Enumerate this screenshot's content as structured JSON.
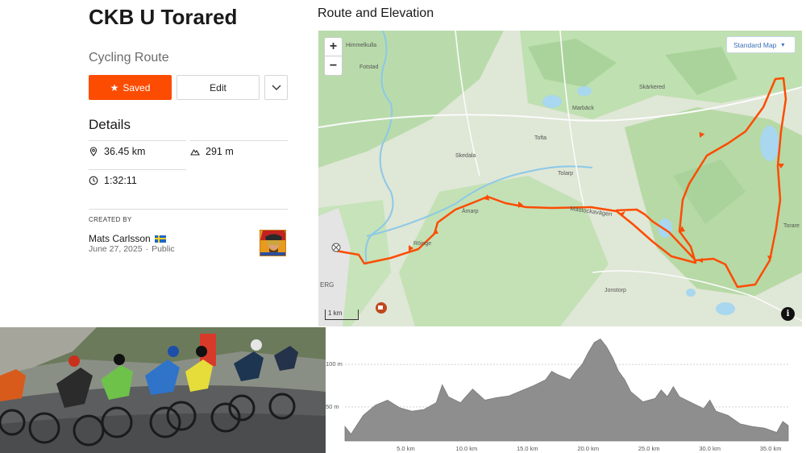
{
  "route": {
    "title": "CKB U Torared",
    "type": "Cycling Route",
    "actions": {
      "saved_label": "Saved",
      "edit_label": "Edit"
    }
  },
  "details": {
    "heading": "Details",
    "distance": "36.45 km",
    "elevation_gain": "291 m",
    "moving_time": "1:32:11"
  },
  "author": {
    "created_by_label": "CREATED BY",
    "name": "Mats Carlsson",
    "date": "June 27, 2025",
    "visibility": "Public"
  },
  "map": {
    "heading": "Route and Elevation",
    "style_selector": "Standard Map",
    "zoom_in": "+",
    "zoom_out": "−",
    "scale": "1 km",
    "info": "i",
    "places": [
      "Himmelkulla",
      "Fotstad",
      "Skedala",
      "Tofta",
      "Marbäck",
      "Skärkered",
      "Tolarp",
      "Åmarp",
      "Röinge",
      "Jonstorp",
      "Torare",
      "ERG"
    ],
    "road": "Mästockavägen",
    "route_color": "#fc4c02"
  },
  "chart_data": {
    "type": "area",
    "title": "",
    "xlabel": "",
    "ylabel": "",
    "x_unit": "km",
    "y_unit": "m",
    "x_ticks": [
      "5.0 km",
      "10.0 km",
      "15.0 km",
      "20.0 km",
      "25.0 km",
      "30.0 km",
      "35.0 km"
    ],
    "y_ticks": [
      "100 m",
      "50 m"
    ],
    "xlim": [
      0,
      36.45
    ],
    "ylim": [
      10,
      140
    ],
    "grid": true,
    "series": [
      {
        "x": [
          0,
          0.5,
          1.5,
          2.5,
          3.5,
          4.5,
          5.5,
          6.5,
          7.5,
          8.0,
          8.5,
          9.5,
          10.5,
          11.5,
          12.5,
          13.5,
          14.5,
          15.5,
          16.5,
          17.0,
          17.5,
          18.5,
          19.0,
          19.5,
          20.0,
          20.5,
          21.0,
          21.5,
          22.0,
          22.5,
          23.0,
          23.5,
          24.5,
          25.5,
          26.0,
          26.5,
          27.0,
          27.5,
          28.5,
          29.5,
          30.0,
          30.5,
          31.5,
          32.5,
          33.5,
          34.5,
          35.5,
          36.0,
          36.45
        ],
        "y": [
          27,
          18,
          40,
          52,
          58,
          49,
          45,
          47,
          55,
          76,
          62,
          55,
          71,
          58,
          61,
          63,
          69,
          75,
          82,
          92,
          88,
          82,
          92,
          100,
          114,
          126,
          130,
          121,
          108,
          92,
          82,
          68,
          56,
          60,
          70,
          62,
          74,
          62,
          55,
          48,
          58,
          45,
          40,
          30,
          27,
          25,
          20,
          33,
          28
        ]
      }
    ]
  }
}
